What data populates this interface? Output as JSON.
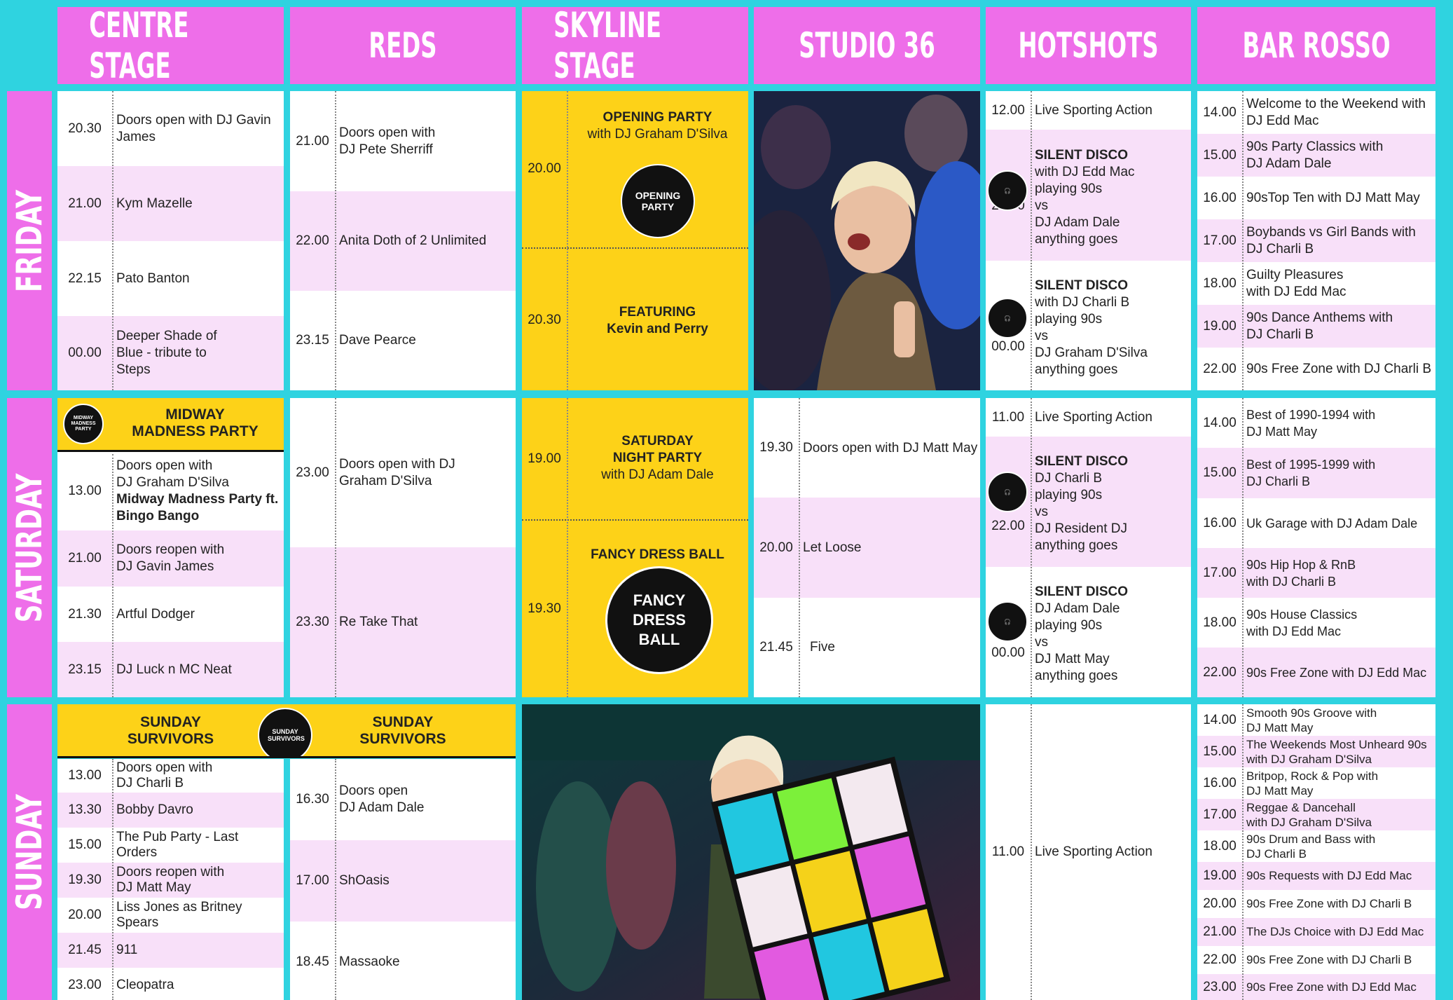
{
  "stages": [
    "CENTRE STAGE",
    "REDS",
    "SKYLINE STAGE",
    "STUDIO 36",
    "HOTSHOTS",
    "BAR ROSSO"
  ],
  "days": [
    "FRIDAY",
    "SATURDAY",
    "SUNDAY"
  ],
  "colors": {
    "background": "#2fd3e0",
    "pink": "#ee6ee9",
    "light_pink": "#f8e0f9",
    "yellow": "#fdd218"
  },
  "friday": {
    "centre": [
      {
        "time": "20.30",
        "desc": "Doors open with DJ Gavin James"
      },
      {
        "time": "21.00",
        "desc": "Kym Mazelle"
      },
      {
        "time": "22.15",
        "desc": "Pato Banton"
      },
      {
        "time": "00.00",
        "desc": "Deeper Shade of Blue - tribute to Steps"
      }
    ],
    "reds": [
      {
        "time": "21.00",
        "desc": "Doors open with DJ Pete Sherriff"
      },
      {
        "time": "22.00",
        "desc": "Anita Doth of 2 Unlimited"
      },
      {
        "time": "23.15",
        "desc": "Dave Pearce"
      }
    ],
    "skyline": {
      "slot1": {
        "time": "20.00",
        "title": "OPENING PARTY",
        "sub": "with DJ Graham D'Silva",
        "badge": "OPENING PARTY"
      },
      "slot2": {
        "time": "20.30",
        "title": "FEATURING",
        "sub": "Kevin and Perry"
      }
    },
    "hotshots": {
      "r1": {
        "time": "12.00",
        "desc": "Live Sporting Action"
      },
      "r2": {
        "time": "22.00",
        "title": "SILENT DISCO",
        "l1": "with DJ Edd Mac",
        "l2": "playing 90s",
        "l3": "vs",
        "l4": "DJ Adam Dale",
        "l5": "anything goes"
      },
      "r3": {
        "time": "00.00",
        "title": "SILENT DISCO",
        "l1": "with DJ Charli B",
        "l2": "playing 90s",
        "l3": "vs",
        "l4": "DJ Graham D'Silva",
        "l5": "anything goes"
      },
      "badge": "SILENT DISCO"
    },
    "barrosso": [
      {
        "time": "14.00",
        "desc": "Welcome to the Weekend with DJ Edd Mac"
      },
      {
        "time": "15.00",
        "desc": "90s Party Classics with DJ Adam Dale"
      },
      {
        "time": "16.00",
        "desc": "90sTop Ten with DJ Matt May"
      },
      {
        "time": "17.00",
        "desc": " Boybands vs Girl Bands with DJ Charli B"
      },
      {
        "time": "18.00",
        "desc": "Guilty Pleasures with DJ Edd Mac"
      },
      {
        "time": "19.00",
        "desc": "90s Dance Anthems with DJ Charli B"
      },
      {
        "time": "22.00",
        "desc": "90s Free Zone with DJ Charli B"
      }
    ]
  },
  "saturday": {
    "centre_banner": {
      "title1": "MIDWAY",
      "title2": "MADNESS PARTY",
      "badge": "MIDWAY MADNESS PARTY"
    },
    "centre": [
      {
        "time": "13.00",
        "l1": "Doors open with",
        "l2": "DJ Graham D'Silva",
        "b1": "Midway Madness Party ft.",
        "b2": "Bingo Bango"
      },
      {
        "time": "21.00",
        "desc": "Doors reopen with DJ Gavin James"
      },
      {
        "time": "21.30",
        "desc": "Artful Dodger"
      },
      {
        "time": "23.15",
        "desc": "DJ Luck n MC Neat"
      }
    ],
    "reds": [
      {
        "time": "23.00",
        "desc": "Doors open with DJ Graham D'Silva"
      },
      {
        "time": "23.30",
        "desc": "Re Take That"
      }
    ],
    "skyline": {
      "slot1": {
        "time": "19.00",
        "title1": "SATURDAY",
        "title2": "NIGHT PARTY",
        "sub": "with DJ Adam Dale"
      },
      "slot2": {
        "time": "19.30",
        "title": "FANCY DRESS BALL",
        "badge": "FANCY DRESS BALL"
      }
    },
    "studio": [
      {
        "time": "19.30",
        "desc": "Doors open with DJ Matt May"
      },
      {
        "time": "20.00",
        "desc": "Let Loose"
      },
      {
        "time": "21.45",
        "desc": "Five"
      }
    ],
    "hotshots": {
      "r1": {
        "time": "11.00",
        "desc": "Live Sporting Action"
      },
      "r2": {
        "time": "22.00",
        "title": "SILENT DISCO",
        "l1": "DJ Charli B",
        "l2": "playing 90s",
        "l3": "vs",
        "l4": "DJ Resident DJ",
        "l5": "anything goes"
      },
      "r3": {
        "time": "00.00",
        "title": "SILENT DISCO",
        "l1": "DJ Adam Dale",
        "l2": "playing 90s",
        "l3": "vs",
        "l4": "DJ Matt May",
        "l5": "anything goes"
      }
    },
    "barrosso": [
      {
        "time": "14.00",
        "desc": "Best of 1990-1994 with DJ Matt May"
      },
      {
        "time": "15.00",
        "desc": "Best of 1995-1999 with DJ Charli B"
      },
      {
        "time": "16.00",
        "desc": "Uk Garage with DJ Adam Dale"
      },
      {
        "time": "17.00",
        "desc": "90s Hip Hop & RnB with DJ Charli B"
      },
      {
        "time": "18.00",
        "desc": "90s House Classics with DJ Edd Mac"
      },
      {
        "time": "22.00",
        "desc": "90s Free Zone with DJ Edd Mac"
      }
    ]
  },
  "sunday": {
    "banner": {
      "left1": "SUNDAY",
      "left2": "SURVIVORS",
      "right1": "SUNDAY",
      "right2": "SURVIVORS",
      "badge": "SUNDAY SURVIVORS"
    },
    "centre": [
      {
        "time": "13.00",
        "desc": "Doors open with DJ Charli B"
      },
      {
        "time": "13.30",
        "desc": "Bobby Davro"
      },
      {
        "time": "15.00",
        "desc": "The Pub Party - Last Orders"
      },
      {
        "time": "19.30",
        "desc": "Doors reopen with DJ Matt May"
      },
      {
        "time": "20.00",
        "desc": "Liss Jones as Britney Spears"
      },
      {
        "time": "21.45",
        "desc": "911"
      },
      {
        "time": "23.00",
        "desc": "Cleopatra"
      }
    ],
    "reds": [
      {
        "time": "16.30",
        "desc": "Doors open DJ Adam Dale"
      },
      {
        "time": "17.00",
        "desc": "ShOasis"
      },
      {
        "time": "18.45",
        "desc": "Massaoke"
      }
    ],
    "hotshots": {
      "time": "11.00",
      "desc": "Live Sporting Action"
    },
    "barrosso": [
      {
        "time": "14.00",
        "desc": "Smooth 90s Groove with DJ Matt May"
      },
      {
        "time": "15.00",
        "desc": "The Weekends Most Unheard 90s with DJ Graham D'Silva"
      },
      {
        "time": "16.00",
        "desc": "Britpop, Rock & Pop with DJ Matt May"
      },
      {
        "time": "17.00",
        "desc": "Reggae & Dancehall with DJ Graham D'Silva"
      },
      {
        "time": "18.00",
        "desc": "90s Drum and Bass with DJ Charli B"
      },
      {
        "time": "19.00",
        "desc": "90s Requests with DJ Edd Mac"
      },
      {
        "time": "20.00",
        "desc": "90s Free Zone with DJ Charli B"
      },
      {
        "time": "21.00",
        "desc": "The DJs Choice with DJ Edd Mac"
      },
      {
        "time": "22.00",
        "desc": "90s Free Zone with DJ Charli B"
      },
      {
        "time": "23.00",
        "desc": "90s Free Zone with DJ Edd Mac"
      }
    ]
  }
}
